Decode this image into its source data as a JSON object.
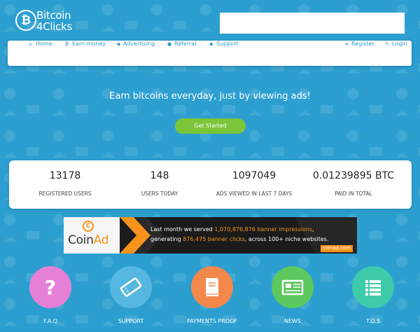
{
  "brand": {
    "logo_line1": "Bitcoin",
    "logo_line2": "4Clicks",
    "logo_symbol": "₿"
  },
  "search": {
    "value": "",
    "placeholder": ""
  },
  "nav": {
    "home": "Home",
    "earn": "Earn money",
    "advertising": "Advertising",
    "referral": "Referral",
    "support": "Support",
    "register": "Register",
    "login": "Login"
  },
  "hero": {
    "title": "Earn bitcoins everyday, just by viewing ads!",
    "cta": "Get Started"
  },
  "stats": [
    {
      "value": "13178",
      "label": "REGISTERED USERS"
    },
    {
      "value": "148",
      "label": "USERS TODAY"
    },
    {
      "value": "1097049",
      "label": "ADS VIEWED IN LAST 7 DAYS"
    },
    {
      "value": "0.01239895 BTC",
      "label": "PAID IN TOTAL"
    }
  ],
  "banner": {
    "brand_coin": "Coin",
    "brand_ad": "Ad",
    "line1_pre": "Last month we served ",
    "line1_hl": "1,070,876,876 banner impressions",
    "line1_post": ",",
    "line2_pre": "generating ",
    "line2_hl": "876,475 banner clicks",
    "line2_post": ", across 100+ niche websites.",
    "domain": "coinad.com"
  },
  "features": [
    {
      "label": "F.A.Q",
      "icon": "question-icon",
      "color": "#e67fd6"
    },
    {
      "label": "SUPPORT",
      "icon": "ticket-icon",
      "color": "#56b8e0"
    },
    {
      "label": "PAYMENTS PROOF",
      "icon": "book-icon",
      "color": "#f3884a"
    },
    {
      "label": "NEWS",
      "icon": "newspaper-icon",
      "color": "#5cc85e"
    },
    {
      "label": "T.O.S",
      "icon": "list-icon",
      "color": "#3ecba9"
    }
  ],
  "colors": {
    "background": "#2c9fd0",
    "nav_text": "#2f9cc5",
    "cta": "#7cc43a",
    "accent": "#f7931a"
  }
}
